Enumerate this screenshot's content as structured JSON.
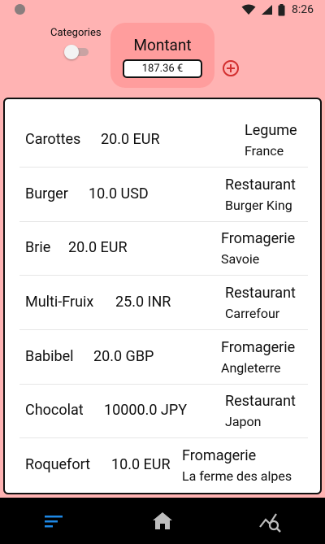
{
  "status_bar": {
    "time": "8:26",
    "icons": [
      "app-dot-icon",
      "wifi-icon",
      "signal-icon",
      "battery-icon"
    ]
  },
  "header": {
    "categories_label": "Categories",
    "categories_toggle": "off",
    "montant_title": "Montant",
    "montant_value": "187.36 €",
    "add_icon": "plus-circle-icon"
  },
  "colors": {
    "background": "#ffb3b3",
    "card": "#ff9d9d",
    "accent": "#d32f2f",
    "nav_active": "#1e88e5"
  },
  "transactions": [
    {
      "name": "Carottes",
      "amount": "20.0 EUR",
      "category": "Legume",
      "place": "France"
    },
    {
      "name": "Burger",
      "amount": "10.0 USD",
      "category": "Restaurant",
      "place": "Burger King"
    },
    {
      "name": "Brie",
      "amount": "20.0 EUR",
      "category": "Fromagerie",
      "place": "Savoie"
    },
    {
      "name": "Multi-Fruix",
      "amount": "25.0 INR",
      "category": "Restaurant",
      "place": "Carrefour"
    },
    {
      "name": "Babibel",
      "amount": "20.0 GBP",
      "category": "Fromagerie",
      "place": "Angleterre"
    },
    {
      "name": "Chocolat",
      "amount": "10000.0 JPY",
      "category": "Restaurant",
      "place": "Japon"
    },
    {
      "name": "Roquefort",
      "amount": "10.0 EUR",
      "category": "Fromagerie",
      "place": "La ferme des alpes"
    }
  ],
  "bottom_nav": {
    "items": [
      "list-icon",
      "home-icon",
      "chart-search-icon"
    ],
    "active": "list-icon"
  }
}
